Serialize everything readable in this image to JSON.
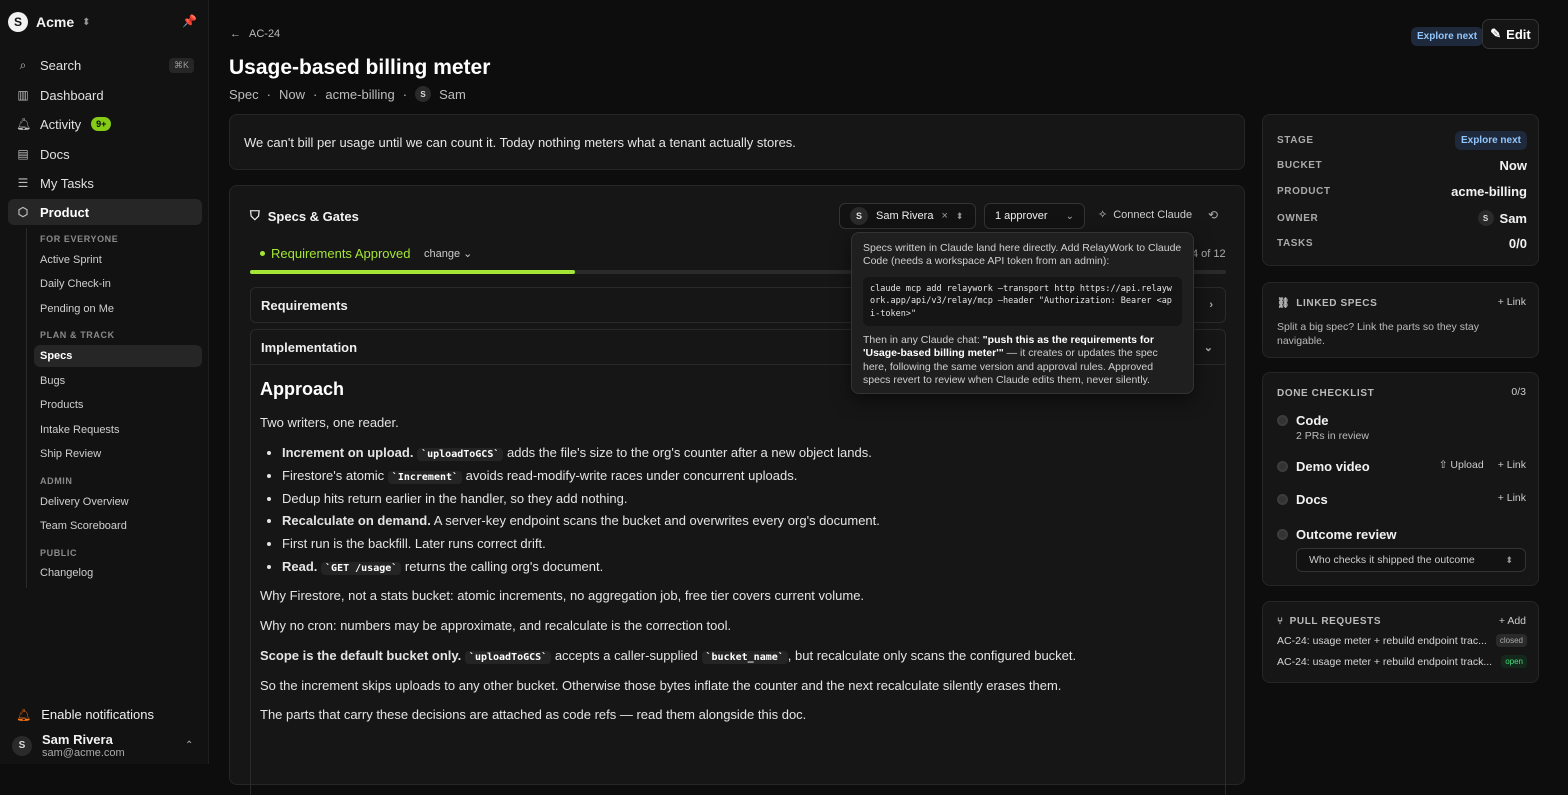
{
  "workspace": {
    "initial": "S",
    "name": "Acme"
  },
  "nav": {
    "search": "Search",
    "search_kbd": "⌘K",
    "dashboard": "Dashboard",
    "activity": "Activity",
    "activity_badge": "9+",
    "docs": "Docs",
    "my_tasks": "My Tasks",
    "product": "Product"
  },
  "subnav": {
    "for_everyone": "FOR EVERYONE",
    "active_sprint": "Active Sprint",
    "daily_checkin": "Daily Check-in",
    "pending": "Pending on Me",
    "plan_track": "PLAN & TRACK",
    "specs": "Specs",
    "bugs": "Bugs",
    "products": "Products",
    "intake": "Intake Requests",
    "ship_review": "Ship Review",
    "admin": "ADMIN",
    "delivery": "Delivery Overview",
    "scoreboard": "Team Scoreboard",
    "public": "PUBLIC",
    "changelog": "Changelog"
  },
  "footer": {
    "notifications": "Enable notifications",
    "user_initial": "S",
    "user_name": "Sam Rivera",
    "user_email": "sam@acme.com"
  },
  "header": {
    "breadcrumb": "AC-24",
    "title": "Usage-based billing meter",
    "meta_type": "Spec",
    "meta_bucket": "Now",
    "meta_product": "acme-billing",
    "meta_owner_initial": "S",
    "meta_owner": "Sam",
    "explore": "Explore next",
    "edit": "Edit"
  },
  "problem": "We can't bill per usage until we can count it. Today nothing meters what a tenant actually stores.",
  "specs": {
    "title": "Specs & Gates",
    "owner_initial": "S",
    "owner": "Sam Rivera",
    "approver": "1 approver",
    "connect": "Connect Claude",
    "tab": "Requirements Approved",
    "change": "change",
    "count": "4 of 12",
    "progress": 0.333,
    "requirements": "Requirements",
    "implementation": "Implementation"
  },
  "doc": {
    "heading": "Approach",
    "intro": "Two writers, one reader.",
    "b1_bold": "Increment on upload.",
    "b1_code": "`uploadToGCS`",
    "b1_rest": " adds the file's size to the org's counter after a new object lands.",
    "b2_pre": "Firestore's atomic ",
    "b2_code": "`Increment`",
    "b2_rest": " avoids read-modify-write races under concurrent uploads.",
    "b3": "Dedup hits return earlier in the handler, so they add nothing.",
    "b4_bold": "Recalculate on demand.",
    "b4_rest": " A server-key endpoint scans the bucket and overwrites every org's document.",
    "b5": "First run is the backfill. Later runs correct drift.",
    "b6_bold": "Read.",
    "b6_code": "`GET /usage`",
    "b6_rest": " returns the calling org's document.",
    "p1": "Why Firestore, not a stats bucket: atomic increments, no aggregation job, free tier covers current volume.",
    "p2": "Why no cron: numbers may be approximate, and recalculate is the correction tool.",
    "p3_bold": "Scope is the default bucket only.",
    "p3_code1": "`uploadToGCS`",
    "p3_mid": " accepts a caller-supplied ",
    "p3_code2": "`bucket_name`",
    "p3_rest": ", but recalculate only scans the configured bucket.",
    "p4": "So the increment skips uploads to any other bucket. Otherwise those bytes inflate the counter and the next recalculate silently erases them.",
    "p5": "The parts that carry these decisions are attached as code refs — read them alongside this doc."
  },
  "popover": {
    "intro": "Specs written in Claude land here directly. Add RelayWork to Claude Code (needs a workspace API token from an admin):",
    "command": "claude mcp add relaywork —transport http https://api.relaywork.app/api/v3/relay/mcp —header \"Authorization: Bearer <api-token>\"",
    "then": "Then in any Claude chat: ",
    "quote": "\"push this as the requirements for 'Usage-based billing meter'\"",
    "rest": " — it creates or updates the spec here, following the same version and approval rules. Approved specs revert to review when Claude edits them, never silently."
  },
  "stage": {
    "stage_k": "STAGE",
    "stage_v": "Explore next",
    "bucket_k": "BUCKET",
    "bucket_v": "Now",
    "product_k": "PRODUCT",
    "product_v": "acme-billing",
    "owner_k": "OWNER",
    "owner_initial": "S",
    "owner_v": "Sam",
    "tasks_k": "TASKS",
    "tasks_v": "0/0"
  },
  "linked": {
    "title": "LINKED SPECS",
    "link": "+ Link",
    "desc": "Split a big spec? Link the parts so they stay navigable."
  },
  "checklist": {
    "title": "DONE CHECKLIST",
    "count": "0/3",
    "code": "Code",
    "code_sub": "2 PRs in review",
    "demo": "Demo video",
    "upload": "⇧ Upload",
    "link": "+ Link",
    "docs": "Docs",
    "outcome": "Outcome review",
    "outcome_select": "Who checks it shipped the outcome"
  },
  "prs": {
    "title": "PULL REQUESTS",
    "add": "+ Add",
    "items": [
      {
        "title": "AC-24: usage meter + rebuild endpoint trac...",
        "status": "closed"
      },
      {
        "title": "AC-24: usage meter + rebuild endpoint track...",
        "status": "open"
      }
    ]
  }
}
